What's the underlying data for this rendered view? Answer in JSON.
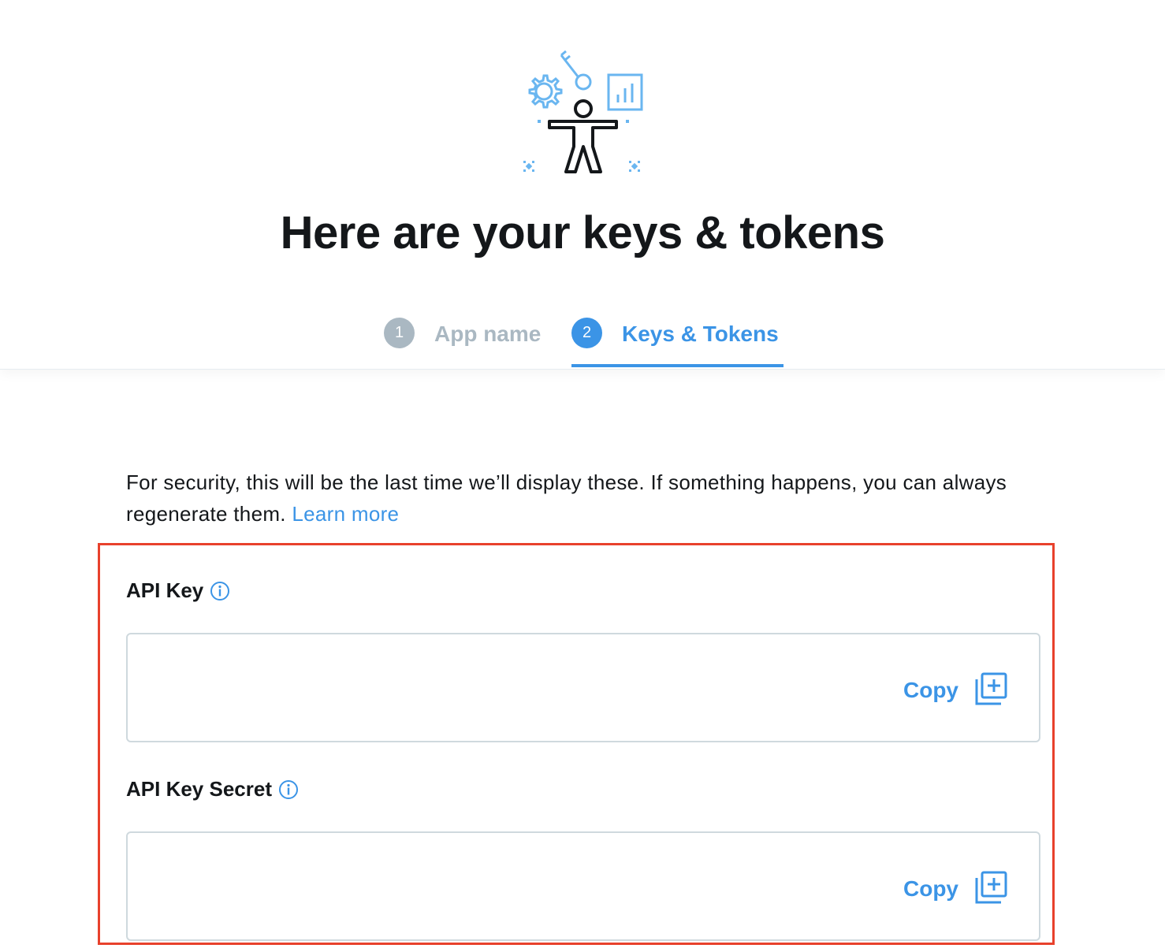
{
  "page": {
    "title": "Here are your keys & tokens"
  },
  "steps": [
    {
      "number": "1",
      "label": "App name",
      "state": "completed"
    },
    {
      "number": "2",
      "label": "Keys & Tokens",
      "state": "active"
    }
  ],
  "intro": {
    "text": "For security, this will be the last time we’ll display these. If something happens, you can always regenerate them.",
    "link_label": "Learn more"
  },
  "fields": [
    {
      "label": "API Key",
      "value": "",
      "copy_label": "Copy",
      "info_icon": "info-icon",
      "copy_icon": "copy-add-icon"
    },
    {
      "label": "API Key Secret",
      "value": "",
      "copy_label": "Copy",
      "info_icon": "info-icon",
      "copy_icon": "copy-add-icon"
    }
  ],
  "colors": {
    "accent": "#3b94e6",
    "inactive": "#aab8c2",
    "highlight_border": "#e8412c",
    "text": "#14171a"
  }
}
